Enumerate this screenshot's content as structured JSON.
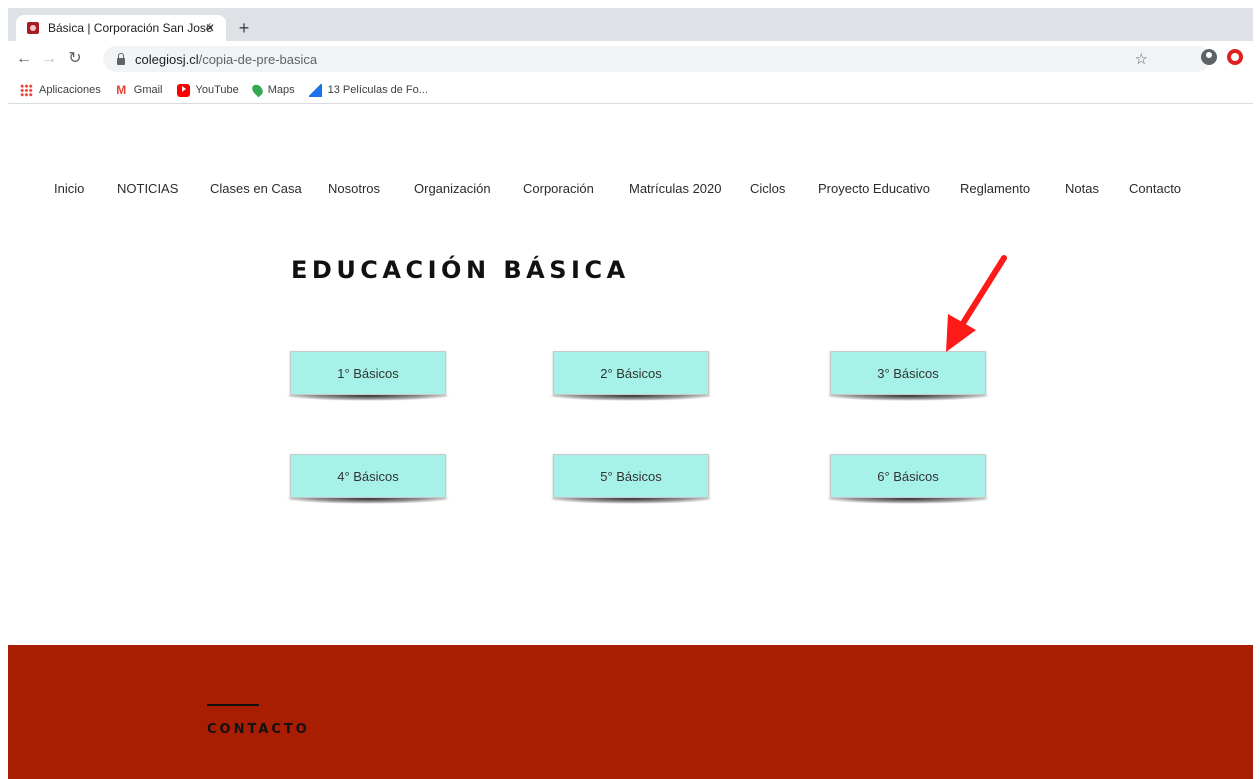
{
  "browser": {
    "tab_title": "Básica | Corporación San José",
    "tab_close": "✕",
    "new_tab": "+",
    "url_host": "colegiosj.cl",
    "url_path": "/copia-de-pre-basica",
    "bookmarks": [
      {
        "label": "Aplicaciones",
        "icon": "apps-icon"
      },
      {
        "label": "Gmail",
        "icon": "gmail-icon"
      },
      {
        "label": "YouTube",
        "icon": "youtube-icon"
      },
      {
        "label": "Maps",
        "icon": "maps-icon"
      },
      {
        "label": "13 Películas de Fo...",
        "icon": "film-icon"
      }
    ]
  },
  "site": {
    "nav": [
      "Inicio",
      "NOTICIAS",
      "Clases en Casa",
      "Nosotros",
      "Organización",
      "Corporación",
      "Matrículas 2020",
      "Ciclos",
      "Proyecto Educativo",
      "Reglamento",
      "Notas",
      "Contacto"
    ],
    "heading": "EDUCACIÓN BÁSICA",
    "grades": [
      "1° Básicos",
      "2° Básicos",
      "3° Básicos",
      "4° Básicos",
      "5° Básicos",
      "6° Básicos"
    ],
    "footer_label": "CONTACTO"
  },
  "colors": {
    "button_bg": "#a6f2e8",
    "footer_bg": "#a91e03",
    "arrow": "#ff1a1a"
  }
}
